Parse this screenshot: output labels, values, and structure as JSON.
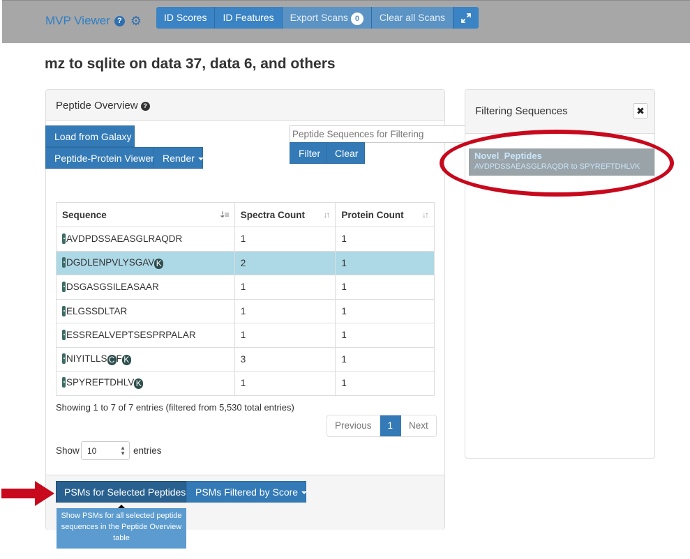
{
  "app": {
    "brand": "MVP Viewer",
    "brand_help": "?",
    "nav": {
      "id_scores": "ID Scores",
      "id_features": "ID Features",
      "export_scans": "Export Scans",
      "export_count": "0",
      "clear_all_scans": "Clear all Scans"
    }
  },
  "page": {
    "title": "mz to sqlite on data 37, data 6, and others"
  },
  "peptide_overview": {
    "title": "Peptide Overview",
    "help": "?",
    "load_from_galaxy": "Load from Galaxy",
    "peptide_protein_viewer": "Peptide-Protein Viewer",
    "render": "Render",
    "filter_placeholder": "Peptide Sequences for Filtering",
    "filter": "Filter",
    "clear": "Clear",
    "table": {
      "headers": {
        "sequence": "Sequence",
        "spectra_count": "Spectra Count",
        "protein_count": "Protein Count"
      },
      "rows": [
        {
          "sequence": "AVDPDSSAEASGLRAQDR",
          "spectra": "1",
          "protein": "1"
        },
        {
          "sequence": "DGDLENPVLYSGAV",
          "mod": "K",
          "spectra": "2",
          "protein": "1"
        },
        {
          "sequence": "DSGASGSILEASAAR",
          "spectra": "1",
          "protein": "1"
        },
        {
          "sequence": "ELGSSDLTAR",
          "spectra": "1",
          "protein": "1"
        },
        {
          "sequence": "ESSREALVEPTSESPRPALAR",
          "spectra": "1",
          "protein": "1"
        },
        {
          "sequence": "NIYITLLS",
          "mod_c": "C",
          "mid": "F",
          "mod": "K",
          "spectra": "3",
          "protein": "1"
        },
        {
          "sequence": "SPYREFTDHLV",
          "mod": "K",
          "spectra": "1",
          "protein": "1"
        }
      ]
    },
    "showing": "Showing 1 to 7 of 7 entries (filtered from 5,530 total entries)",
    "pagination": {
      "previous": "Previous",
      "current": "1",
      "next": "Next"
    },
    "show_label": "Show",
    "show_value": "10",
    "entries_label": "entries",
    "psms_selected": "PSMs for Selected Peptides",
    "psms_filtered": "PSMs Filtered by Score",
    "tooltip": "Show PSMs for all selected peptide sequences in the Peptide Overview table"
  },
  "filtering_sequences": {
    "title": "Filtering Sequences",
    "close": "✖",
    "item_name": "Novel_Peptides",
    "item_range": "AVDPDSSAEASGLRAQDR to SPYREFTDHLVK"
  },
  "colors": {
    "primary": "#337ab7",
    "selected_row": "#add8e6",
    "annotation_red": "#c8081c",
    "topbar": "#a7a7a7"
  }
}
